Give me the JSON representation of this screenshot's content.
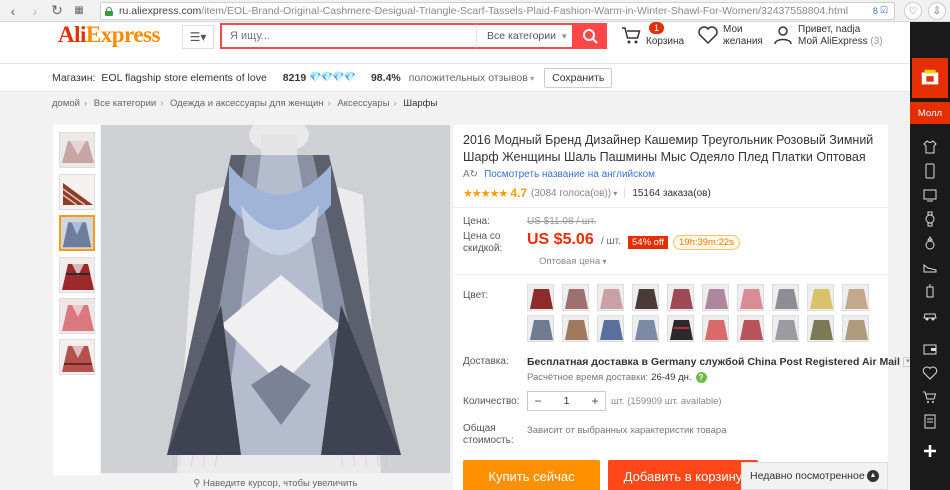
{
  "browser": {
    "url_domain": "ru.aliexpress.com",
    "url_path": "/item/EOL-Brand-Original-Cashmere-Desigual-Triangle-Scarf-Tassels-Plaid-Fashion-Warm-in-Winter-Shawl-For-Women/32437558804.html",
    "badge_count": "8"
  },
  "header": {
    "logo_main": "Ali",
    "logo_accent": "Express",
    "search_placeholder": "Я ищу...",
    "category_label": "Все категории",
    "cart_count": "1",
    "cart_label": "Корзина",
    "wishlist_line1": "Мои",
    "wishlist_line2": "желания",
    "account_line1": "Привет, nadja",
    "account_line2": "Мой AliExpress",
    "account_count": "(3)"
  },
  "store": {
    "label": "Магазин:",
    "name": "EOL flagship store elements of love",
    "score": "8219",
    "diamonds": "💎💎💎💎",
    "positive_pct": "98.4%",
    "positive_label": "положительных отзывов",
    "save_label": "Сохранить"
  },
  "breadcrumb": [
    "домой",
    "Все категории",
    "Одежда и аксессуары для женщин",
    "Аксессуары",
    "Шарфы"
  ],
  "gallery": {
    "zoom_hint": "Наведите курсор, чтобы увеличить"
  },
  "product": {
    "title": "2016 Модный Бренд Дизайнер Кашемир Треугольник Розовый Зимний Шарф Женщины Шаль Пашмины Мыс Одеяло Плед Платки Оптовая",
    "translate_link": "Посмотреть название на английском",
    "rating_stars": "★★★★★",
    "rating_value": "4.7",
    "votes": "(3084 голоса(ов))",
    "orders": "15164 заказа(ов)",
    "price_label": "Цена:",
    "old_price": "US $11.08 / шт.",
    "discount_label_1": "Цена со",
    "discount_label_2": "скидкой:",
    "price": "US $5.06",
    "per_unit": "/ шт.",
    "discount_badge": "54% off",
    "timer": "19h:39m:22s",
    "wholesale": "Оптовая цена",
    "color_label": "Цвет:",
    "shipping_label": "Доставка:",
    "shipping_text": "Бесплатная доставка в Germany службой China Post Registered Air Mail",
    "shipping_est_label": "Расчётное время доставки:",
    "shipping_est_value": "26-49 дн.",
    "qty_label": "Количество:",
    "qty_value": "1",
    "qty_available": "шт. (159909 шт. available)",
    "total_label_1": "Общая",
    "total_label_2": "стоимость:",
    "total_value": "Зависит от выбранных характеристик товара",
    "buy_label": "Купить сейчас",
    "cart_label": "Добавить в корзину"
  },
  "recent": {
    "label": "Недавно посмотренное"
  },
  "sidebar": {
    "moll_label": "Молл"
  }
}
